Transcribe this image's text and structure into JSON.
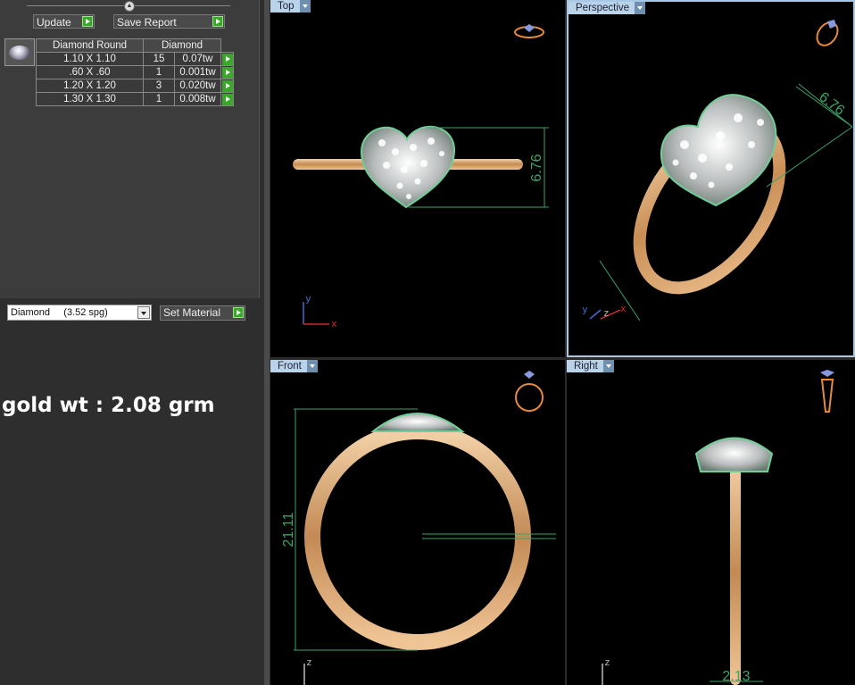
{
  "toolbar": {
    "update_label": "Update",
    "save_report_label": "Save Report"
  },
  "table": {
    "headers": [
      "Diamond Round",
      "Diamond"
    ],
    "rows": [
      {
        "size": "1.10 X 1.10",
        "count": "15",
        "weight": "0.07tw"
      },
      {
        "size": ".60 X .60",
        "count": "1",
        "weight": "0.001tw"
      },
      {
        "size": "1.20 X 1.20",
        "count": "3",
        "weight": "0.020tw"
      },
      {
        "size": "1.30 X 1.30",
        "count": "1",
        "weight": "0.008tw"
      }
    ]
  },
  "material": {
    "selected": "Diamond     (3.52 spg)",
    "set_label": "Set Material"
  },
  "gold_weight": "gold wt : 2.08 grm",
  "viewports": {
    "top": {
      "label": "Top",
      "dimension": "6.76"
    },
    "perspective": {
      "label": "Perspective",
      "dimension": "6.76"
    },
    "front": {
      "label": "Front",
      "dimension": "21.11"
    },
    "right": {
      "label": "Right",
      "dimension": "2.13"
    }
  },
  "axes": {
    "x": "x",
    "y": "y",
    "z": "z"
  },
  "colors": {
    "gold": "#d8a770",
    "dimension": "#3ba56a",
    "viewport_label": "#b9d3ea"
  }
}
